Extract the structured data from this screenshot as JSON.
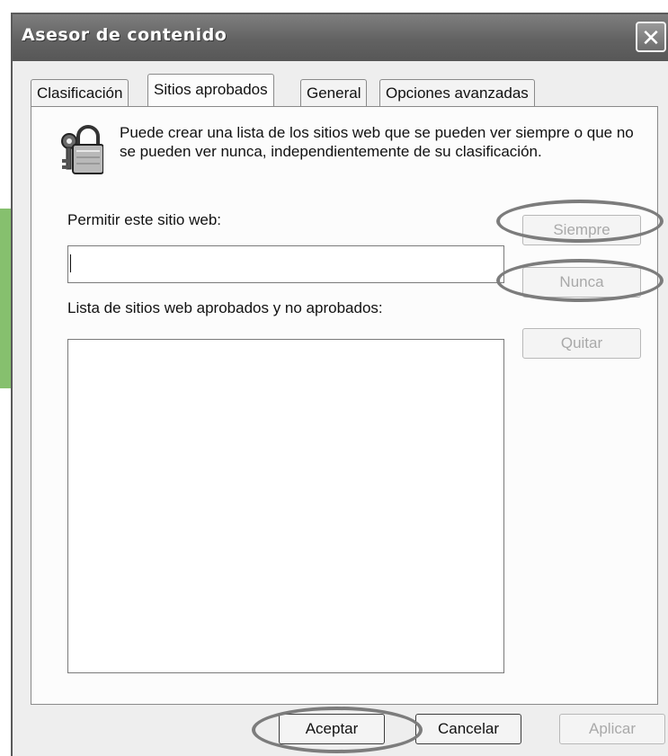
{
  "window": {
    "title": "Asesor de contenido",
    "close_icon": "close-icon"
  },
  "tabs": [
    {
      "label": "Clasificación",
      "active": false
    },
    {
      "label": "Sitios aprobados",
      "active": true
    },
    {
      "label": "General",
      "active": false
    },
    {
      "label": "Opciones avanzadas",
      "active": false
    }
  ],
  "panel": {
    "icon": "lock-keys-icon",
    "description": "Puede crear una lista de los sitios web que se pueden ver siempre o que no se pueden ver nunca, independientemente de su clasificación.",
    "allow_label": "Permitir este sitio web:",
    "url_value": "",
    "list_label": "Lista de sitios web aprobados y no aprobados:",
    "list_items": [],
    "buttons": {
      "always": "Siempre",
      "never": "Nunca",
      "remove": "Quitar"
    }
  },
  "footer": {
    "accept": "Aceptar",
    "cancel": "Cancelar",
    "apply": "Aplicar"
  },
  "colors": {
    "annotation_arrow": "#86c06e",
    "highlight_ring": "#7c7c7c"
  }
}
